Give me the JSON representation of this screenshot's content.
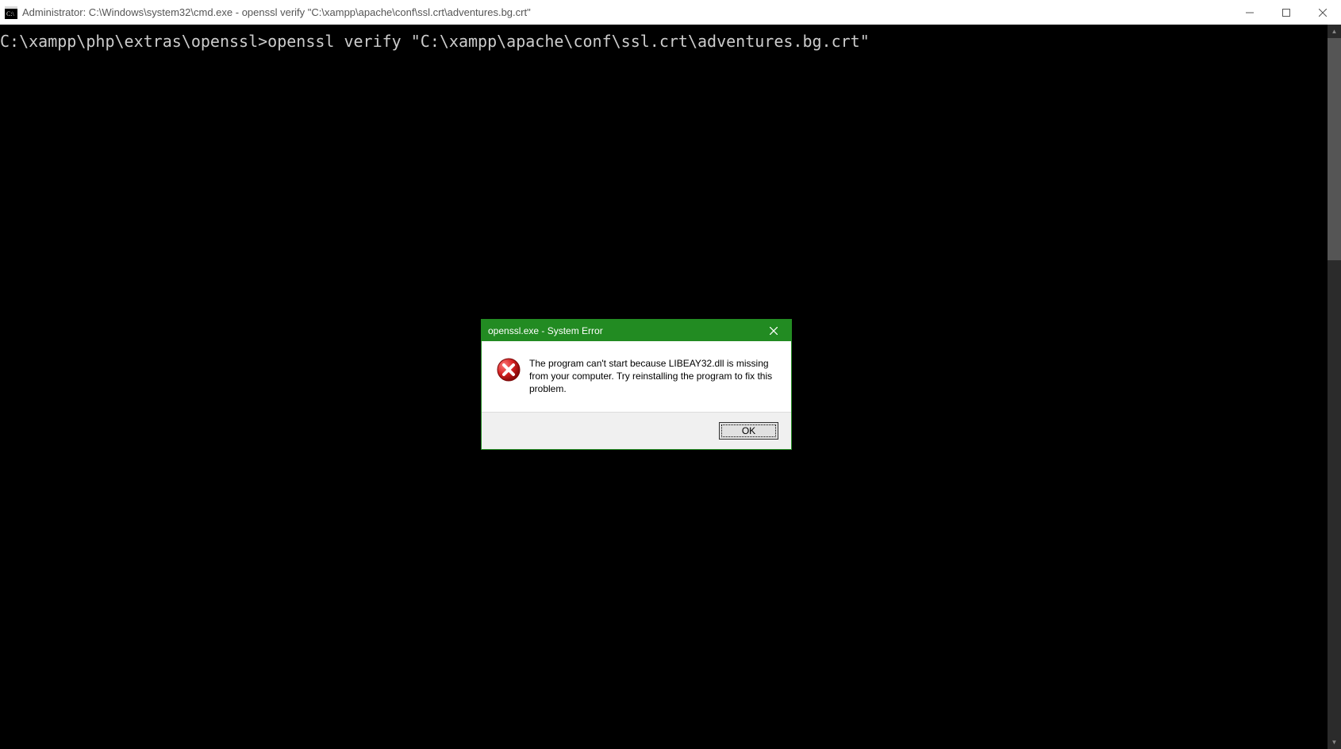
{
  "window": {
    "title": "Administrator: C:\\Windows\\system32\\cmd.exe - openssl  verify \"C:\\xampp\\apache\\conf\\ssl.crt\\adventures.bg.crt\""
  },
  "terminal": {
    "line1": "C:\\xampp\\php\\extras\\openssl>openssl verify \"C:\\xampp\\apache\\conf\\ssl.crt\\adventures.bg.crt\""
  },
  "dialog": {
    "title": "openssl.exe - System Error",
    "message": "The program can't start because LIBEAY32.dll is missing from your computer. Try reinstalling the program to fix this problem.",
    "ok_label": "OK"
  }
}
